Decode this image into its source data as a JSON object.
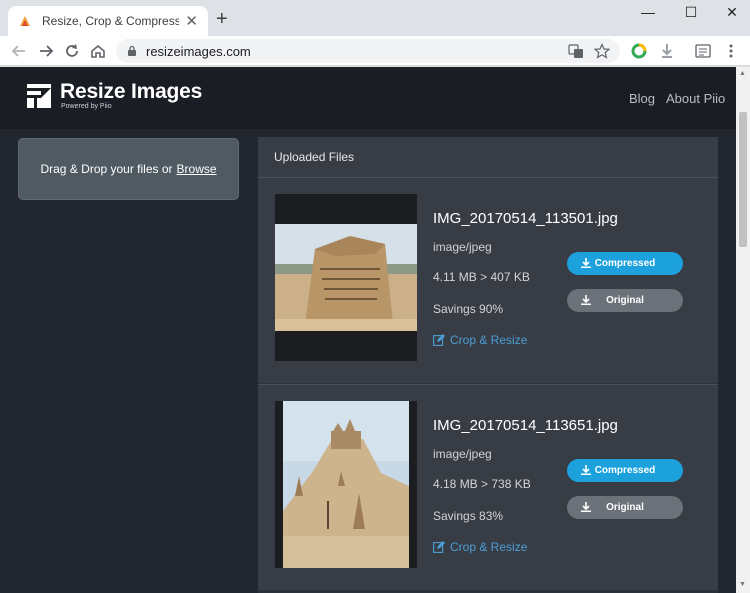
{
  "browser": {
    "tab_title": "Resize, Crop & Compress Imag",
    "url": "resizeimages.com"
  },
  "header": {
    "brand": "Resize Images",
    "powered_by": "Powered by Piio",
    "nav": [
      {
        "label": "Blog"
      },
      {
        "label": "About Piio"
      }
    ]
  },
  "dropzone": {
    "text": "Drag & Drop your files or",
    "browse": "Browse"
  },
  "files_panel": {
    "title": "Uploaded Files",
    "files": [
      {
        "name": "IMG_20170514_113501.jpg",
        "type": "image/jpeg",
        "size": "4.11 MB > 407 KB",
        "savings": "Savings 90%",
        "crop_label": "Crop & Resize",
        "compressed_label": "Compressed",
        "original_label": "Original"
      },
      {
        "name": "IMG_20170514_113651.jpg",
        "type": "image/jpeg",
        "size": "4.18 MB > 738 KB",
        "savings": "Savings 83%",
        "crop_label": "Crop & Resize",
        "compressed_label": "Compressed",
        "original_label": "Original"
      }
    ]
  },
  "colors": {
    "accent": "#1da1dc",
    "link": "#4b9fd8",
    "header_bg": "#1a1d23",
    "page_bg": "#22262e"
  }
}
